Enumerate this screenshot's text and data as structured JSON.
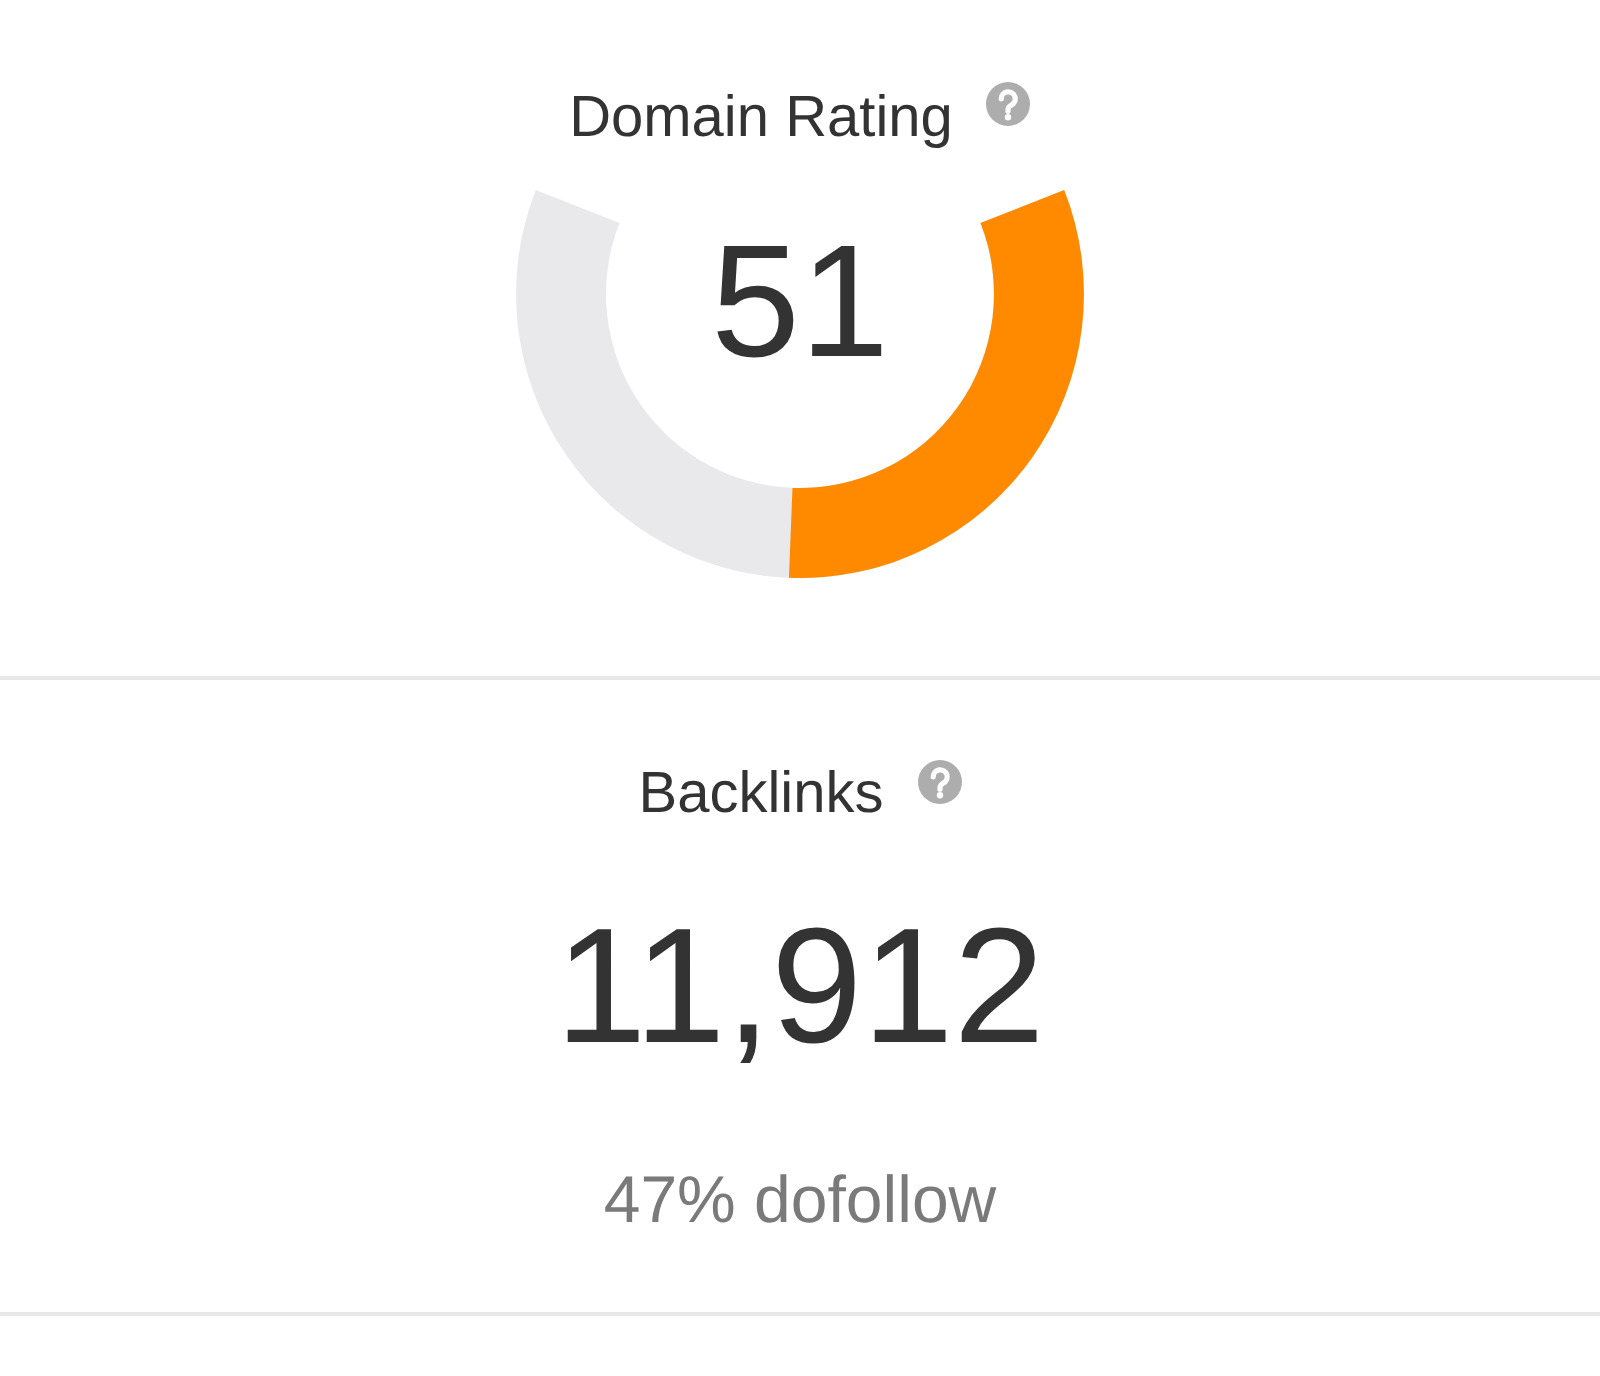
{
  "domain_rating": {
    "label": "Domain Rating",
    "value": "51",
    "gauge": {
      "level": 0.51
    }
  },
  "backlinks": {
    "label": "Backlinks",
    "value": "11,912",
    "subtext": "47% dofollow"
  }
}
